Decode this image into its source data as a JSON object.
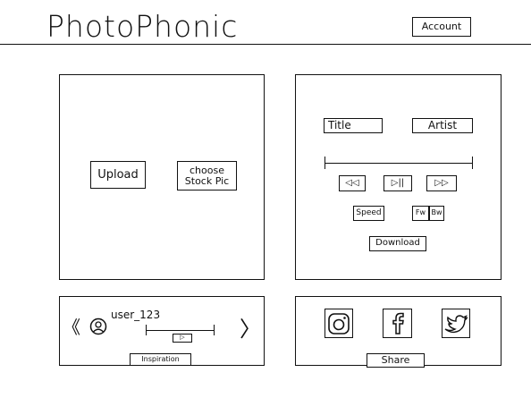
{
  "header": {
    "app_title": "PhotoPhonic",
    "account_label": "Account"
  },
  "image_panel": {
    "upload_label": "Upload",
    "stock_label_line1": "choose",
    "stock_label_line2": "Stock Pic"
  },
  "player_panel": {
    "title_label": "Title",
    "artist_label": "Artist",
    "rewind_glyph": "◁◁",
    "playpause_glyph": "▷||",
    "forward_glyph": "▷▷",
    "speed_label": "Speed",
    "fw_label": "Fw",
    "bw_label": "Bw",
    "download_label": "Download"
  },
  "inspiration_panel": {
    "prev_glyph": "《",
    "next_glyph": "〉",
    "username": "user_123",
    "inspiration_label": "Inspiration"
  },
  "share_panel": {
    "share_label": "Share"
  }
}
